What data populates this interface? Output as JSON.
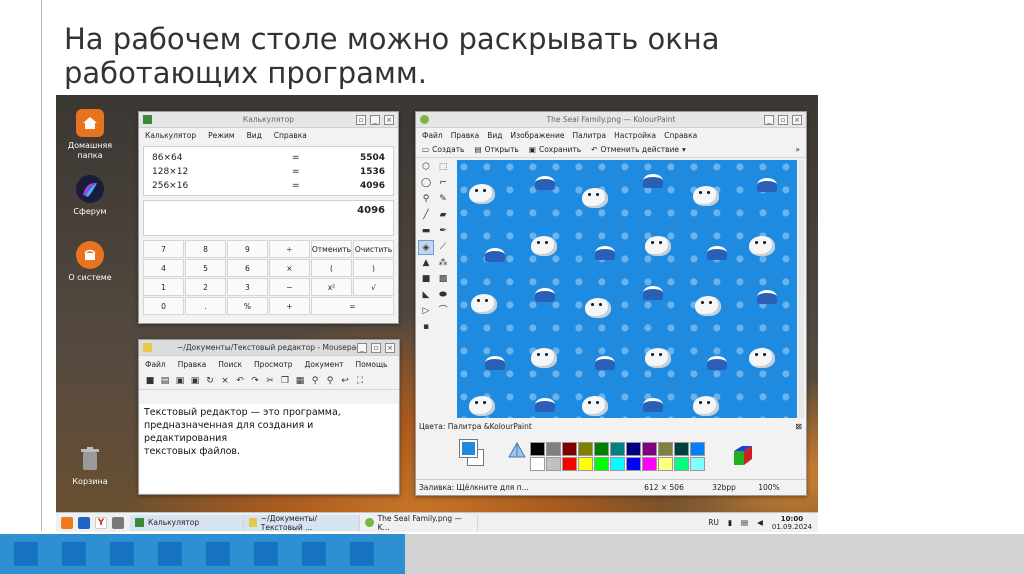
{
  "slide": {
    "title": "На рабочем столе можно раскрывать окна работающих программ."
  },
  "desktop": {
    "icons": [
      {
        "name": "home-folder-icon",
        "label": "Домашняя папка",
        "color": "#e8731f"
      },
      {
        "name": "sferum-icon",
        "label": "Сферум",
        "color": "#5a2ea6"
      },
      {
        "name": "about-system-icon",
        "label": "О системе",
        "color": "#e8731f"
      },
      {
        "name": "trash-icon",
        "label": "Корзина",
        "color": "#888888"
      }
    ]
  },
  "calculator": {
    "title": "Калькулятор",
    "menu": [
      "Калькулятор",
      "Режим",
      "Вид",
      "Справка"
    ],
    "history": [
      {
        "expr": "86×64",
        "eq": "=",
        "res": "5504"
      },
      {
        "expr": "128×12",
        "eq": "=",
        "res": "1536"
      },
      {
        "expr": "256×16",
        "eq": "=",
        "res": "4096"
      }
    ],
    "display": "4096",
    "keys": [
      "7",
      "8",
      "9",
      "÷",
      "Отменить",
      "Очистить",
      "4",
      "5",
      "6",
      "×",
      "(",
      ")",
      "1",
      "2",
      "3",
      "−",
      "x²",
      "√",
      "0",
      ".",
      "%",
      "+",
      "=",
      ""
    ]
  },
  "editor": {
    "title": "~/Документы/Текстовый редактор - Mousepad",
    "menu": [
      "Файл",
      "Правка",
      "Поиск",
      "Просмотр",
      "Документ",
      "Помощь"
    ],
    "text": "Текстовый редактор — это программа,\nпредназначенная для создания и редактирования\nтекстовых файлов."
  },
  "paint": {
    "title": "The Seal Family.png — KolourPaint",
    "menu": [
      "Файл",
      "Правка",
      "Вид",
      "Изображение",
      "Палитра",
      "Настройка",
      "Справка"
    ],
    "toolbar": {
      "create": "Создать",
      "open": "Открыть",
      "save": "Сохранить",
      "undo": "Отменить действие"
    },
    "colors_label": "Цвета: Палитра &KolourPaint",
    "palette": [
      "#000000",
      "#808080",
      "#800000",
      "#808000",
      "#008000",
      "#008080",
      "#000080",
      "#800080",
      "#808040",
      "#004040",
      "#0080ff",
      "#ffffff",
      "#c0c0c0",
      "#ff0000",
      "#ffff00",
      "#00ff00",
      "#00ffff",
      "#0000ff",
      "#ff00ff",
      "#ffff80",
      "#00ff80",
      "#80ffff"
    ],
    "status": {
      "hint": "Заливка: Щёлкните для п...",
      "size": "612 × 506",
      "depth": "32bpp",
      "zoom": "100%"
    }
  },
  "taskbar": {
    "tasks": [
      "Калькулятор",
      "~/Документы/Текстовый ...",
      "The Seal Family.png — K..."
    ],
    "lang": "RU",
    "time": "10:00",
    "date": "01.09.2024"
  }
}
